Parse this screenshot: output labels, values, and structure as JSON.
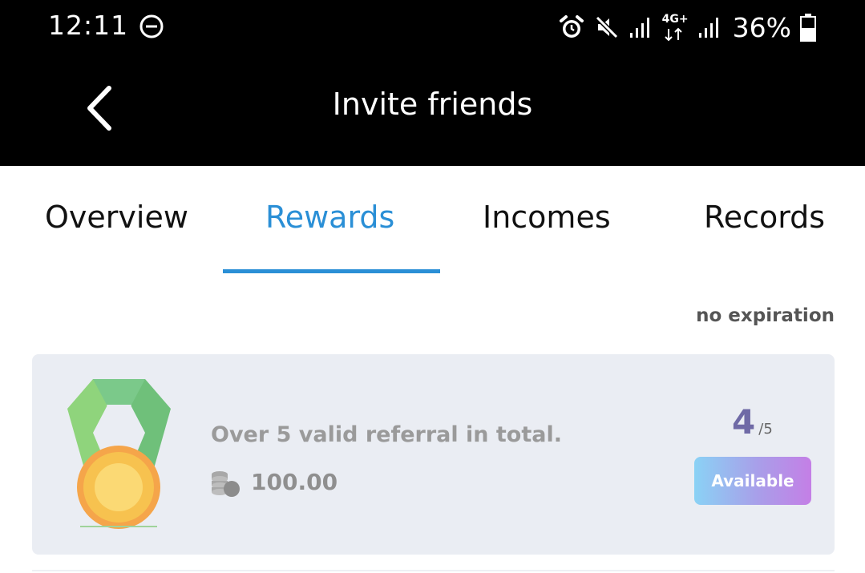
{
  "status_bar": {
    "time": "12:11",
    "network": "4G+",
    "battery_percent": "36%",
    "icons": [
      "do-not-disturb-icon",
      "alarm-icon",
      "mute-icon",
      "signal-icon",
      "data-arrows-icon",
      "signal-icon",
      "battery-icon"
    ]
  },
  "header": {
    "title": "Invite friends",
    "back_icon": "chevron-left-icon"
  },
  "tabs": [
    {
      "label": "Overview",
      "active": false
    },
    {
      "label": "Rewards",
      "active": true
    },
    {
      "label": "Incomes",
      "active": false
    },
    {
      "label": "Records",
      "active": false
    }
  ],
  "rewards": {
    "expiry_note": "no expiration",
    "items": [
      {
        "icon": "medal-icon",
        "description": "Over 5 valid referral in total.",
        "amount_icon": "coins-icon",
        "amount": "100.00",
        "progress_current": "4",
        "progress_separator": "/",
        "progress_total": "5",
        "button_label": "Available"
      }
    ]
  },
  "colors": {
    "accent": "#2a8fd6",
    "topbar": "#000000",
    "card_bg": "#eaedf3",
    "progress": "#6f6aa6",
    "button_gradient": [
      "#8ad2f5",
      "#a99ee9",
      "#c47fe6"
    ]
  }
}
